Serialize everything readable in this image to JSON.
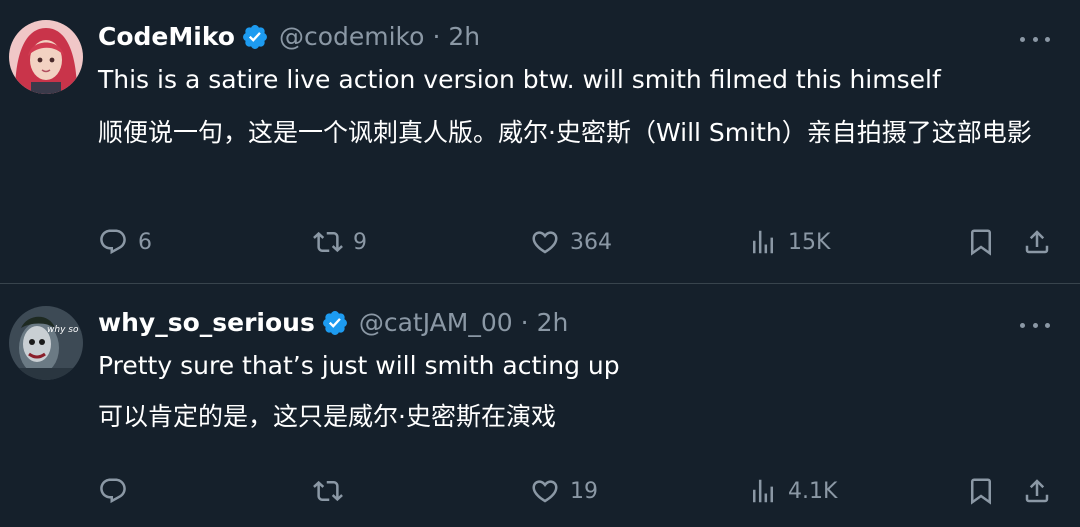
{
  "tweets": [
    {
      "display_name": "CodeMiko",
      "handle": "@codemiko",
      "separator": "·",
      "time": "2h",
      "text_en": "This is a satire live action version btw. will smith filmed this himself",
      "text_zh": "顺便说一句，这是一个讽刺真人版。威尔·史密斯（Will Smith）亲自拍摄了这部电影",
      "replies": "6",
      "reposts": "9",
      "likes": "364",
      "views": "15K",
      "avatar_icon": "avatar-redhair-girl"
    },
    {
      "display_name": "why_so_serious",
      "handle": "@catJAM_00",
      "separator": "·",
      "time": "2h",
      "text_en": "Pretty sure that’s just will smith acting up",
      "text_zh": "可以肯定的是，这只是威尔·史密斯在演戏",
      "replies": "",
      "reposts": "",
      "likes": "19",
      "views": "4.1K",
      "avatar_text": "why so serious?",
      "avatar_icon": "avatar-joker"
    }
  ],
  "colors": {
    "background": "#15202b",
    "text": "#ffffff",
    "secondary": "#8b98a5",
    "divider": "#38444d",
    "verified": "#1d9bf0"
  },
  "icons": [
    "verified-badge-icon",
    "more-icon",
    "reply-icon",
    "repost-icon",
    "like-icon",
    "views-icon",
    "bookmark-icon",
    "share-icon"
  ]
}
